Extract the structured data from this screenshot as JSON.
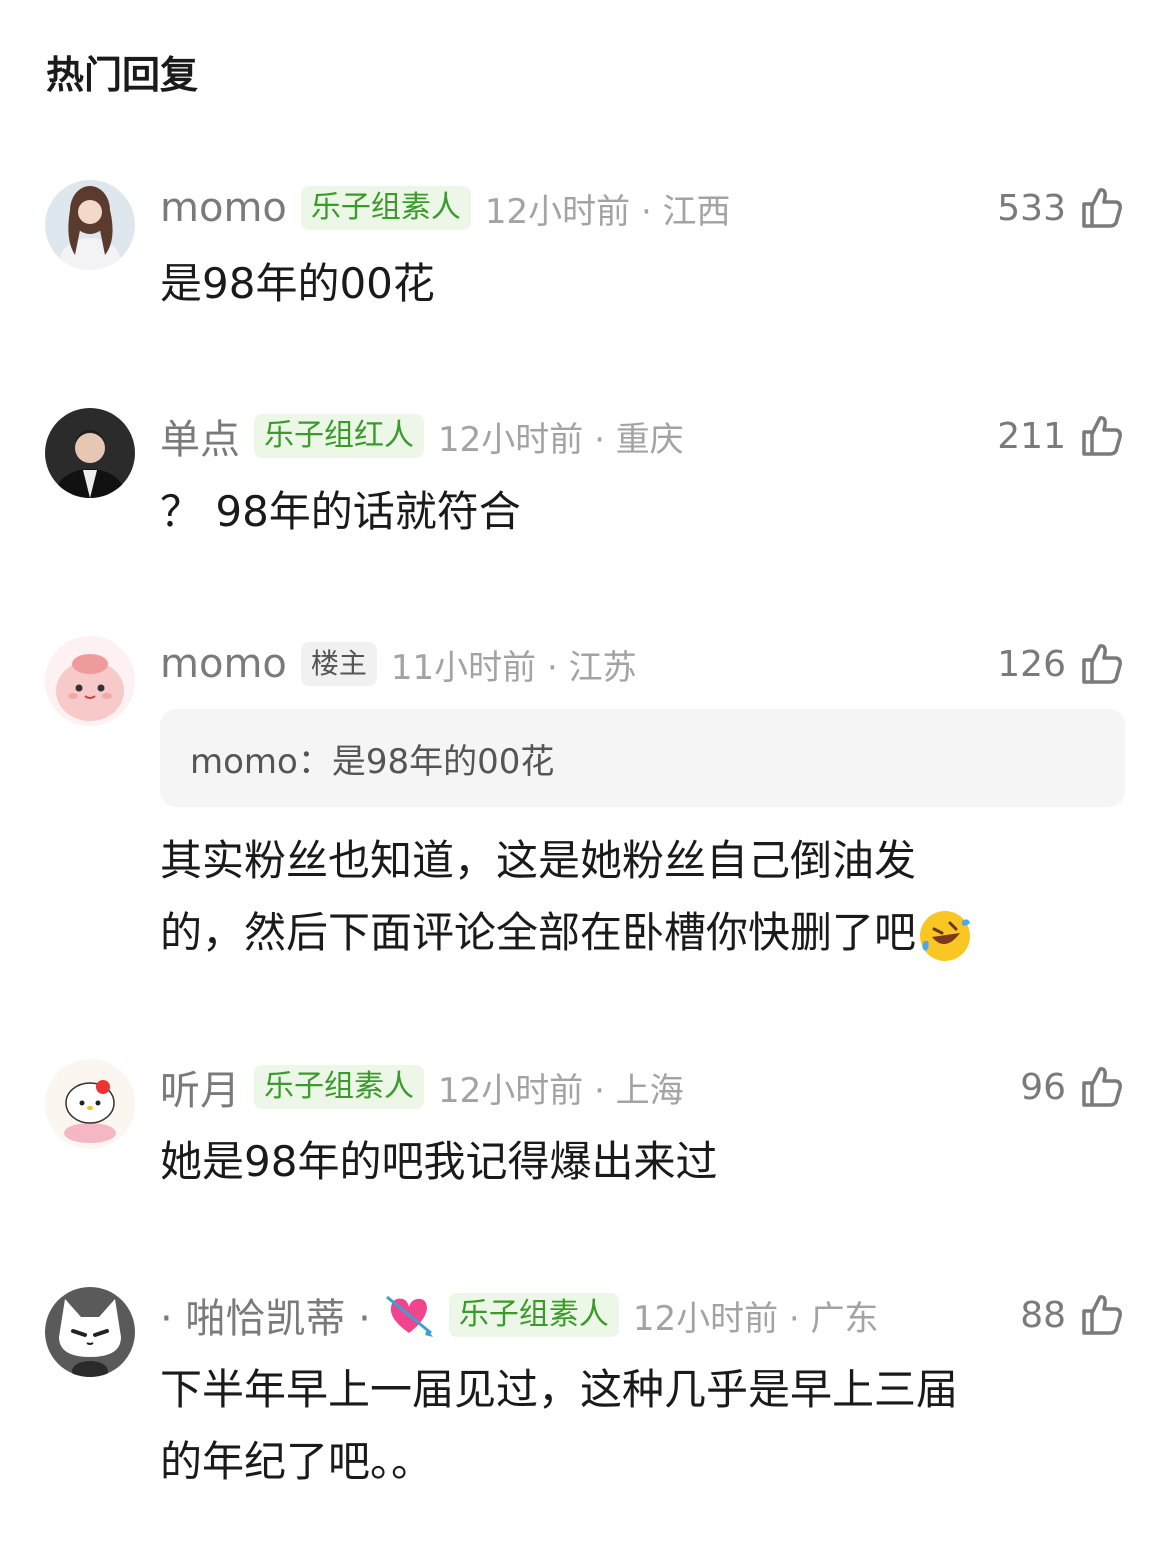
{
  "section_title": "热门回复",
  "comments": [
    {
      "username": "momo",
      "badge": "乐子组素人",
      "meta": "12小时前 · 江西",
      "likes": "533",
      "text": "是98年的00花"
    },
    {
      "username": "单点",
      "badge": "乐子组红人",
      "meta": "12小时前 · 重庆",
      "likes": "211",
      "text": "？ 98年的话就符合"
    },
    {
      "username": "momo",
      "badge": "楼主",
      "meta": "11小时前 · 江苏",
      "likes": "126",
      "quote": "momo：是98年的00花",
      "text_line1": "其实粉丝也知道，这是她粉丝自己倒油发",
      "text_line2": "的，然后下面评论全部在卧槽你快删了吧"
    },
    {
      "username": "听月",
      "badge": "乐子组素人",
      "meta": "12小时前 · 上海",
      "likes": "96",
      "text": "她是98年的吧我记得爆出来过"
    },
    {
      "username": "· 啪恰凯蒂 ·",
      "badge": "乐子组素人",
      "meta": "12小时前 · 广东",
      "likes": "88",
      "text_line1": "下半年早上一届见过，这种几乎是早上三届",
      "text_line2": "的年纪了吧。。"
    }
  ],
  "colors": {
    "badge_bg": "#ecf7e7",
    "badge_text": "#3b9a2c",
    "meta_text": "#a3a3a3",
    "username_text": "#7a7a7a"
  },
  "icons": [
    "thumbs-up-icon",
    "rofl-emoji",
    "heart-arrow-emoji"
  ]
}
